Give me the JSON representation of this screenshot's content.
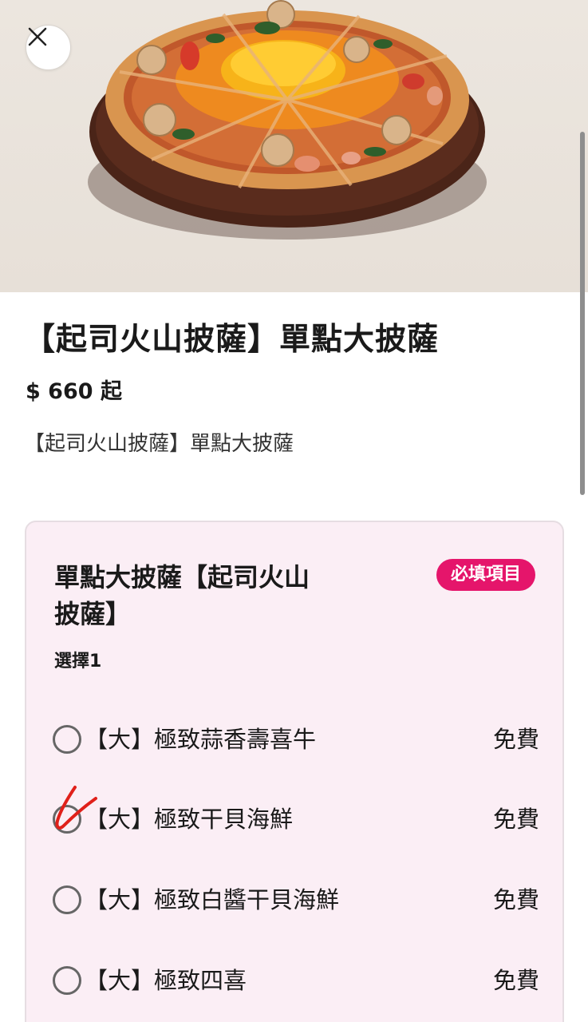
{
  "product": {
    "title": "【起司火山披薩】單點大披薩",
    "price": "$ 660 起",
    "description": "【起司火山披薩】單點大披薩"
  },
  "option_group": {
    "title": "單點大披薩【起司火山披薩】",
    "required_badge": "必填項目",
    "select_hint": "選擇1",
    "options": [
      {
        "label": "【大】極致蒜香壽喜牛",
        "price": "免費"
      },
      {
        "label": "【大】極致干貝海鮮",
        "price": "免費",
        "hand_marked": true
      },
      {
        "label": "【大】極致白醬干貝海鮮",
        "price": "免費"
      },
      {
        "label": "【大】極致四喜",
        "price": "免費"
      }
    ]
  },
  "icons": {
    "close": "close-icon",
    "radio": "radio-icon",
    "annotation": "handwritten-checkmark-icon"
  },
  "colors": {
    "accent": "#e5156b",
    "card_background": "#fbeef5",
    "annotation": "#e0201a"
  }
}
